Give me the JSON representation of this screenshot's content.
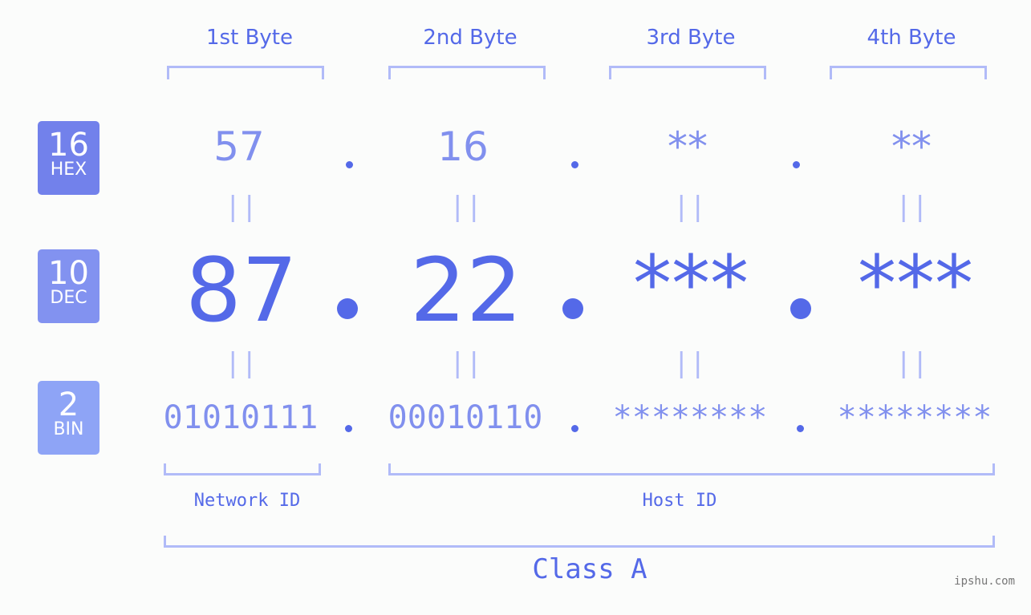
{
  "bytes": [
    {
      "label": "1st Byte",
      "hex": "57",
      "dec": "87",
      "bin": "01010111"
    },
    {
      "label": "2nd Byte",
      "hex": "16",
      "dec": "22",
      "bin": "00010110"
    },
    {
      "label": "3rd Byte",
      "hex": "**",
      "dec": "***",
      "bin": "********"
    },
    {
      "label": "4th Byte",
      "hex": "**",
      "dec": "***",
      "bin": "********"
    }
  ],
  "badges": {
    "hex": {
      "num": "16",
      "sub": "HEX",
      "color": "#7281eb"
    },
    "dec": {
      "num": "10",
      "sub": "DEC",
      "color": "#8292f0"
    },
    "bin": {
      "num": "2",
      "sub": "BIN",
      "color": "#8ea4f6"
    }
  },
  "equals_glyph": "||",
  "sections": {
    "network_id": "Network ID",
    "host_id": "Host ID",
    "class": "Class A"
  },
  "watermark": "ipshu.com",
  "colors": {
    "primary": "#5469e8",
    "secondary": "#8190ee",
    "bracket": "#b1bbf8",
    "background": "#fbfcfb"
  }
}
